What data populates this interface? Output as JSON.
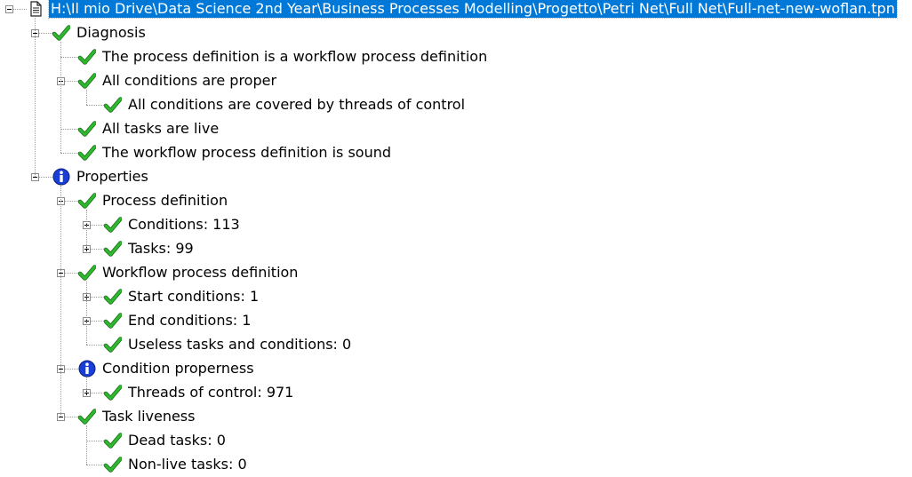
{
  "tree": {
    "root": {
      "label": "H:\\Il mio Drive\\Data Science 2nd Year\\Business Processes Modelling\\Progetto\\Petri Net\\Full Net\\Full-net-new-woflan.tpn",
      "icon": "document-icon",
      "expanded": true,
      "selected": true,
      "children": [
        {
          "label": "Diagnosis",
          "icon": "check-icon",
          "expanded": true,
          "children": [
            {
              "label": "The process definition is a workflow process definition",
              "icon": "check-icon"
            },
            {
              "label": "All conditions are proper",
              "icon": "check-icon",
              "expanded": true,
              "children": [
                {
                  "label": "All conditions are covered by threads of control",
                  "icon": "check-icon"
                }
              ]
            },
            {
              "label": "All tasks are live",
              "icon": "check-icon"
            },
            {
              "label": "The workflow process definition is sound",
              "icon": "check-icon"
            }
          ]
        },
        {
          "label": "Properties",
          "icon": "info-icon",
          "expanded": true,
          "children": [
            {
              "label": "Process definition",
              "icon": "check-icon",
              "expanded": true,
              "children": [
                {
                  "label": "Conditions: 113",
                  "icon": "check-icon",
                  "expanded": false,
                  "hasChildren": true
                },
                {
                  "label": "Tasks: 99",
                  "icon": "check-icon",
                  "expanded": false,
                  "hasChildren": true
                }
              ]
            },
            {
              "label": "Workflow process definition",
              "icon": "check-icon",
              "expanded": true,
              "children": [
                {
                  "label": "Start conditions: 1",
                  "icon": "check-icon",
                  "expanded": false,
                  "hasChildren": true
                },
                {
                  "label": "End conditions: 1",
                  "icon": "check-icon",
                  "expanded": false,
                  "hasChildren": true
                },
                {
                  "label": "Useless tasks and conditions: 0",
                  "icon": "check-icon"
                }
              ]
            },
            {
              "label": "Condition properness",
              "icon": "info-icon",
              "expanded": true,
              "children": [
                {
                  "label": "Threads of control: 971",
                  "icon": "check-icon",
                  "expanded": false,
                  "hasChildren": true
                }
              ]
            },
            {
              "label": "Task liveness",
              "icon": "check-icon",
              "expanded": true,
              "children": [
                {
                  "label": "Dead tasks: 0",
                  "icon": "check-icon"
                },
                {
                  "label": "Non-live tasks: 0",
                  "icon": "check-icon"
                }
              ]
            }
          ]
        }
      ]
    }
  },
  "colors": {
    "selection": "#0078d7",
    "check": "#2db82d",
    "info": "#1a3fd6"
  }
}
